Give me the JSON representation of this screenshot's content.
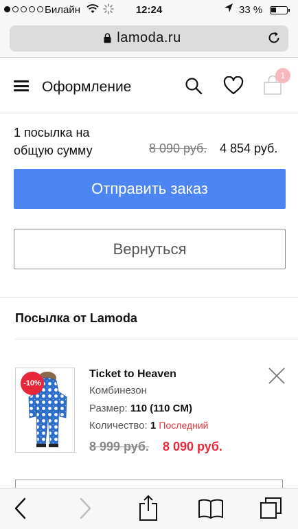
{
  "status_bar": {
    "carrier": "Билайн",
    "time": "12:24",
    "battery": "33 %"
  },
  "browser": {
    "url": "lamoda.ru"
  },
  "header": {
    "title": "Оформление",
    "cart_count": "1"
  },
  "summary": {
    "label": "1 посылка на общую сумму",
    "old_total": "8 090 руб.",
    "new_total": "4 854 руб."
  },
  "actions": {
    "submit_label": "Отправить заказ",
    "back_label": "Вернуться"
  },
  "section": {
    "title": "Посылка от Lamoda"
  },
  "product": {
    "discount_badge": "-10%",
    "brand": "Ticket to Heaven",
    "type": "Комбинезон",
    "size_label": "Размер:",
    "size_value": "110 (110 CM)",
    "qty_label": "Количество:",
    "qty_value": "1",
    "qty_note": "Последний",
    "old_price": "8 999 руб.",
    "new_price": "8 090 руб."
  },
  "colors": {
    "primary_button": "#4c84f2",
    "sale_red": "#e8273a"
  },
  "icons": [
    "menu-icon",
    "search-icon",
    "heart-icon",
    "cart-icon",
    "close-icon",
    "back-icon",
    "forward-icon",
    "share-icon",
    "bookmarks-icon",
    "tabs-icon",
    "lock-icon",
    "reload-icon",
    "wifi-icon",
    "location-icon",
    "battery-icon"
  ]
}
